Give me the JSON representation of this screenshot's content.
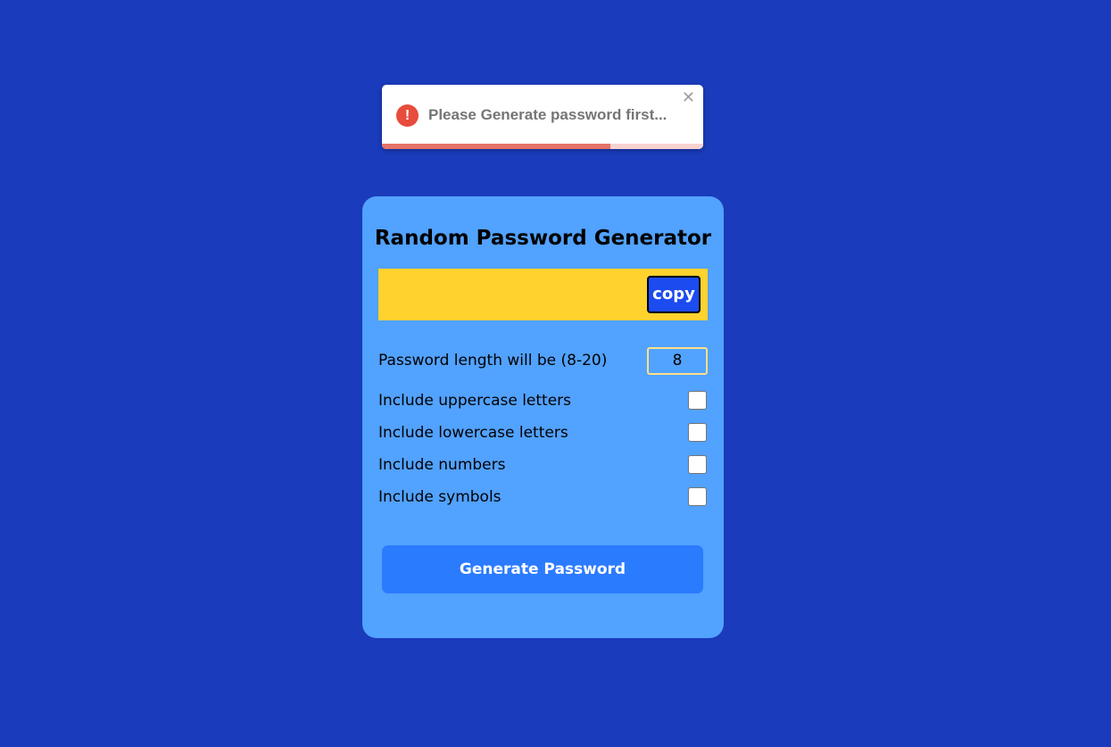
{
  "toast": {
    "icon": "exclamation-circle-icon",
    "icon_glyph": "!",
    "message": "Please Generate password first...",
    "close_glyph": "✕",
    "progress": 0.71,
    "colors": {
      "icon": "#e74c3c",
      "progress": "#e57368",
      "track": "#f7d3d0"
    }
  },
  "card": {
    "title": "Random Password Generator",
    "password_value": "",
    "copy_label": "copy",
    "length": {
      "label": "Password length will be (8-20)",
      "value": "8"
    },
    "options": [
      {
        "label": "Include uppercase letters",
        "checked": false
      },
      {
        "label": "Include lowercase letters",
        "checked": false
      },
      {
        "label": "Include numbers",
        "checked": false
      },
      {
        "label": "Include symbols",
        "checked": false
      }
    ],
    "generate_label": "Generate Password"
  },
  "colors": {
    "background": "#1a3bbb",
    "card": "#52a2ff",
    "output": "#ffd22e",
    "copy_button": "#1c4bf0",
    "generate_button": "#2b7bff"
  }
}
